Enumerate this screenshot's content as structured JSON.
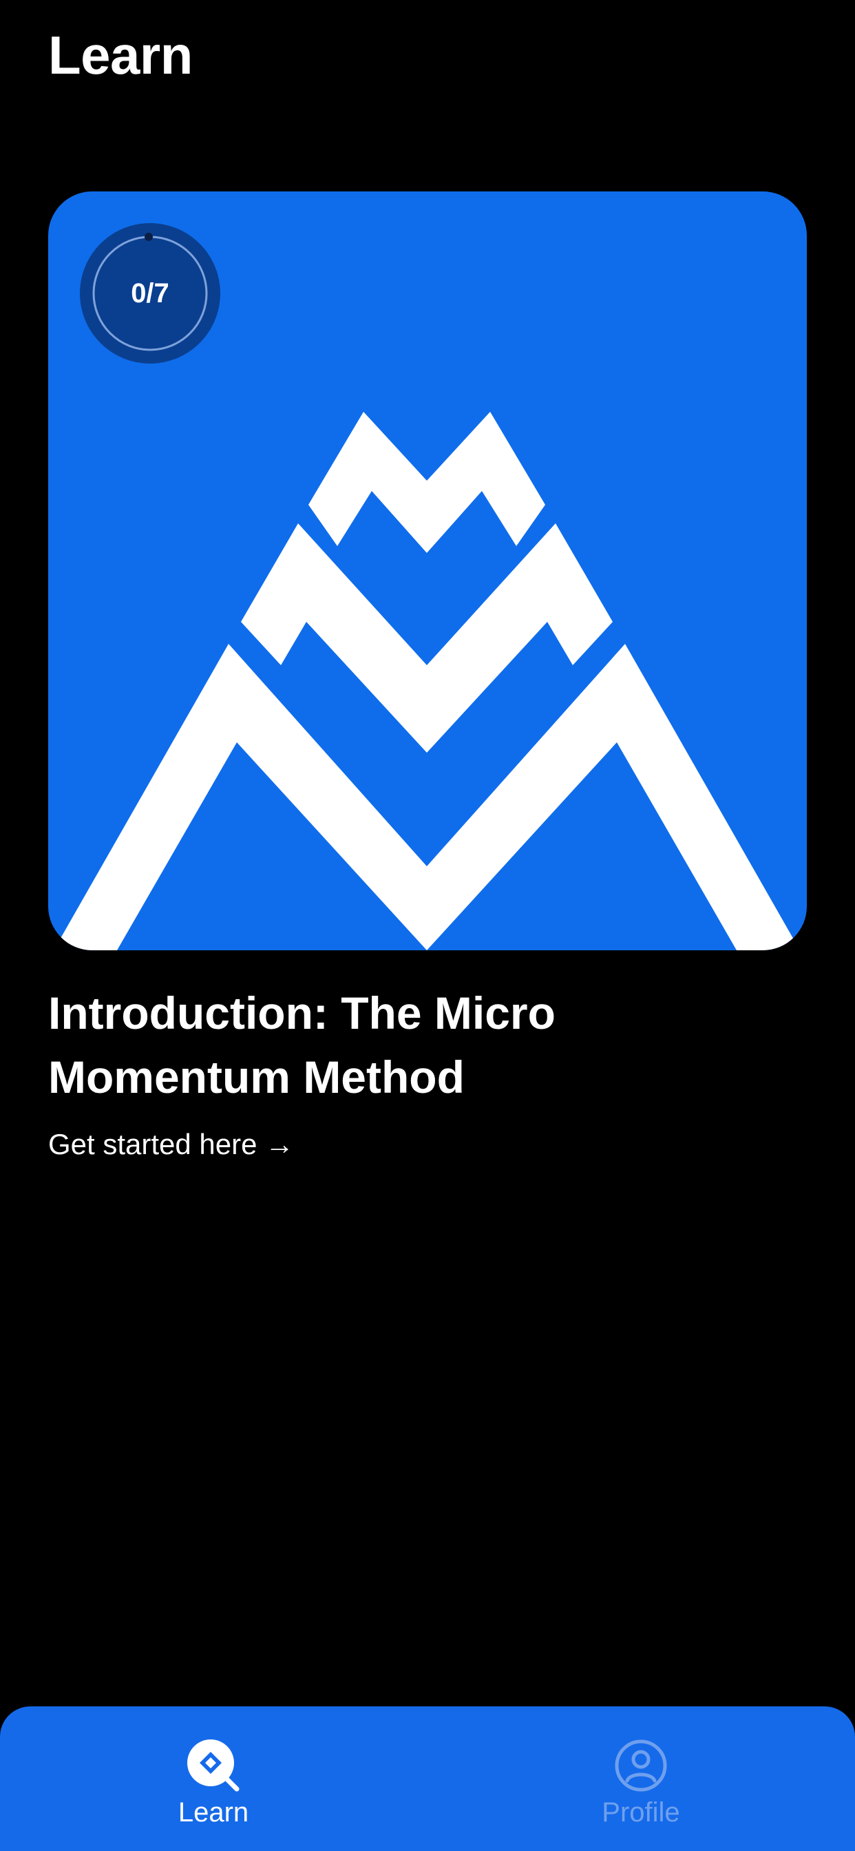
{
  "header": {
    "title": "Learn"
  },
  "course": {
    "progress_text": "0/7",
    "progress_fraction": 0,
    "title": "Introduction: The Micro Momentum Method",
    "link_label": "Get started here →",
    "logo_icon": "micro-momentum-mountain-logo",
    "card_color": "#0f6deb"
  },
  "tab_bar": {
    "background": "#156aea",
    "tabs": [
      {
        "label": "Learn",
        "icon": "learn-search-diamond-icon",
        "active": true
      },
      {
        "label": "Profile",
        "icon": "profile-person-icon",
        "active": false
      }
    ]
  }
}
